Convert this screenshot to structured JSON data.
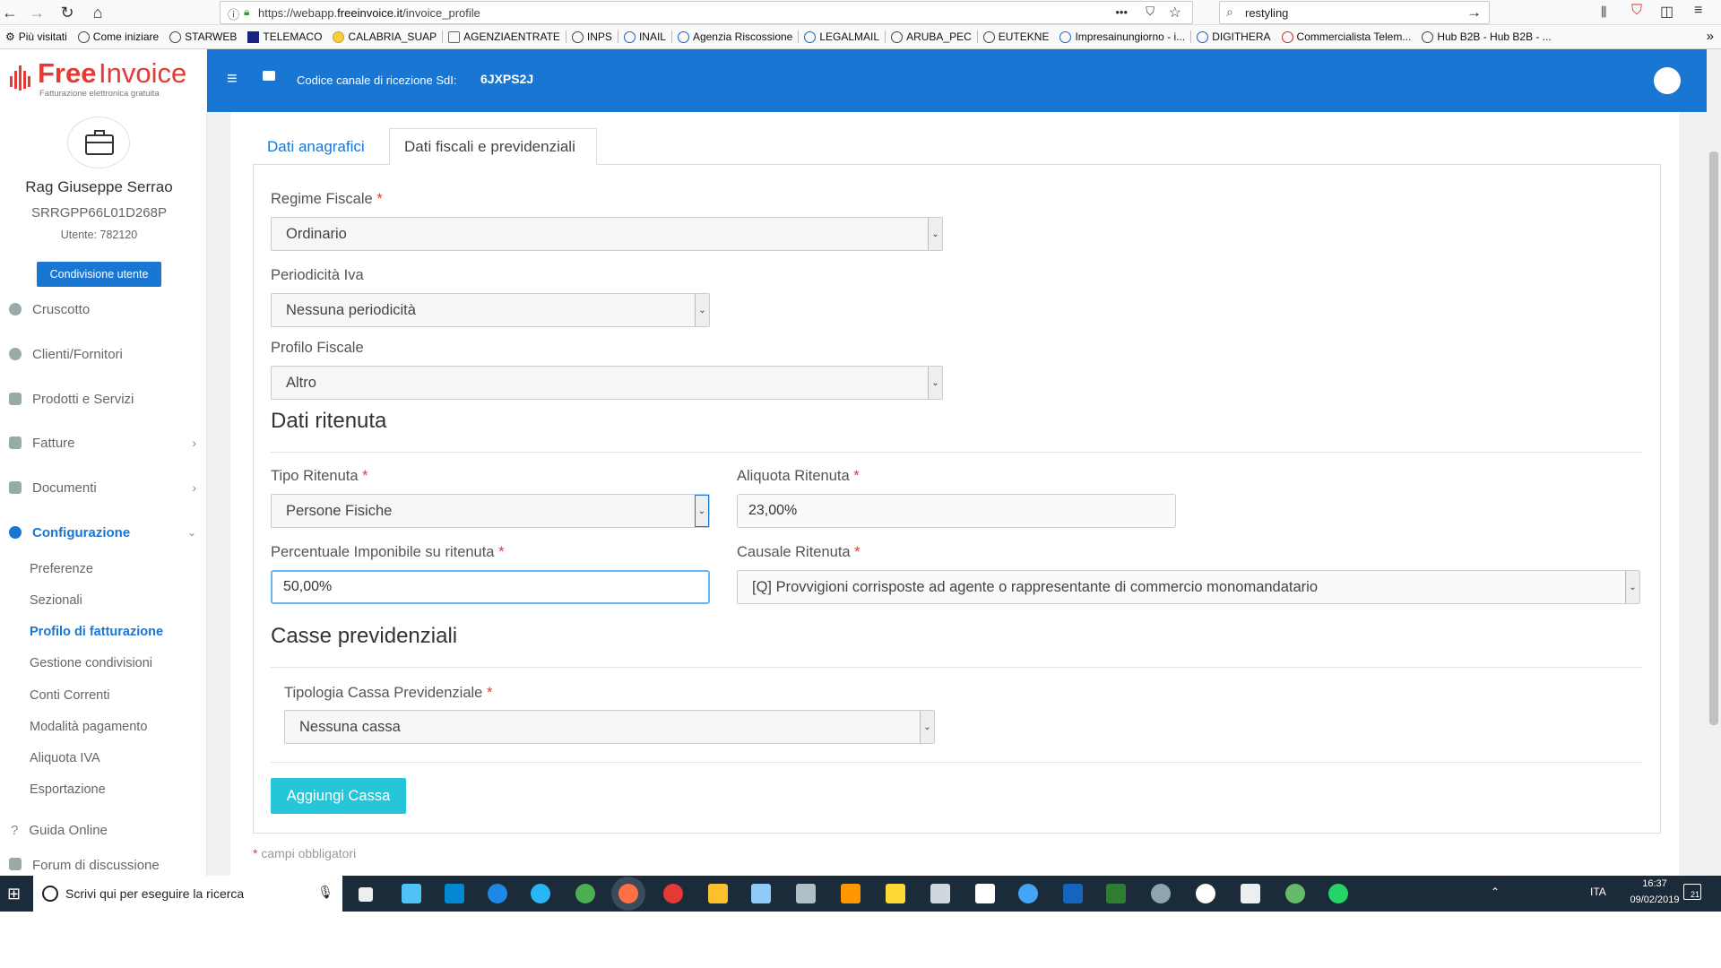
{
  "browser": {
    "url_prefix": "https://webapp.",
    "url_domain": "freeinvoice.it",
    "url_path": "/invoice_profile",
    "search_value": "restyling",
    "menu_dots": "•••"
  },
  "bookmarks": [
    "Più visitati",
    "Come iniziare",
    "STARWEB",
    "TELEMACO",
    "CALABRIA_SUAP",
    "AGENZIAENTRATE",
    "INPS",
    "INAIL",
    "Agenzia Riscossione",
    "LEGALMAIL",
    "ARUBA_PEC",
    "EUTEKNE",
    "Impresainungiorno - i...",
    "DIGITHERA",
    "Commercialista Telem...",
    "Hub B2B - Hub B2B - ..."
  ],
  "logo": {
    "free": "Free",
    "invoice": "Invoice",
    "tagline": "Fatturazione elettronica gratuita"
  },
  "header": {
    "sdi_label": "Codice canale di ricezione SdI:",
    "sdi_code": "6JXPS2J"
  },
  "user": {
    "name": "Rag Giuseppe Serrao",
    "fiscal_code": "SRRGPP66L01D268P",
    "id_label": "Utente: 782120",
    "share_button": "Condivisione utente"
  },
  "sidebar": {
    "items": [
      {
        "label": "Cruscotto"
      },
      {
        "label": "Clienti/Fornitori"
      },
      {
        "label": "Prodotti e Servizi"
      },
      {
        "label": "Fatture"
      },
      {
        "label": "Documenti"
      },
      {
        "label": "Configurazione"
      }
    ],
    "sub_items": [
      {
        "label": "Preferenze"
      },
      {
        "label": "Sezionali"
      },
      {
        "label": "Profilo di fatturazione"
      },
      {
        "label": "Gestione condivisioni"
      },
      {
        "label": "Conti Correnti"
      },
      {
        "label": "Modalità pagamento"
      },
      {
        "label": "Aliquota IVA"
      },
      {
        "label": "Esportazione"
      }
    ],
    "guide": "Guida Online",
    "forum": "Forum di discussione"
  },
  "tabs": {
    "anagrafici": "Dati anagrafici",
    "fiscali": "Dati fiscali e previdenziali"
  },
  "form": {
    "regime_label": "Regime Fiscale",
    "regime_value": "Ordinario",
    "periodicita_label": "Periodicità Iva",
    "periodicita_value": "Nessuna periodicità",
    "profilo_label": "Profilo Fiscale",
    "profilo_value": "Altro",
    "ritenuta_title": "Dati ritenuta",
    "tipo_label": "Tipo Ritenuta",
    "tipo_value": "Persone Fisiche",
    "aliquota_label": "Aliquota Ritenuta",
    "aliquota_value": "23,00%",
    "percentuale_label": "Percentuale Imponibile su ritenuta",
    "percentuale_value": "50,00%",
    "causale_label": "Causale Ritenuta",
    "causale_value": "[Q] Provvigioni corrisposte ad agente o rappresentante di commercio monomandatario",
    "casse_title": "Casse previdenziali",
    "cassa_label": "Tipologia Cassa Previdenziale",
    "cassa_value": "Nessuna cassa",
    "add_button": "Aggiungi Cassa",
    "required_note": "campi obbligatori",
    "required_mark": "*"
  },
  "taskbar": {
    "search_placeholder": "Scrivi qui per eseguire la ricerca",
    "lang": "ITA",
    "time": "16:37",
    "date": "09/02/2019",
    "notif_count": "21"
  },
  "colors": {
    "primary": "#1976d2",
    "accent": "#26c6da",
    "logo_red": "#e53935"
  }
}
